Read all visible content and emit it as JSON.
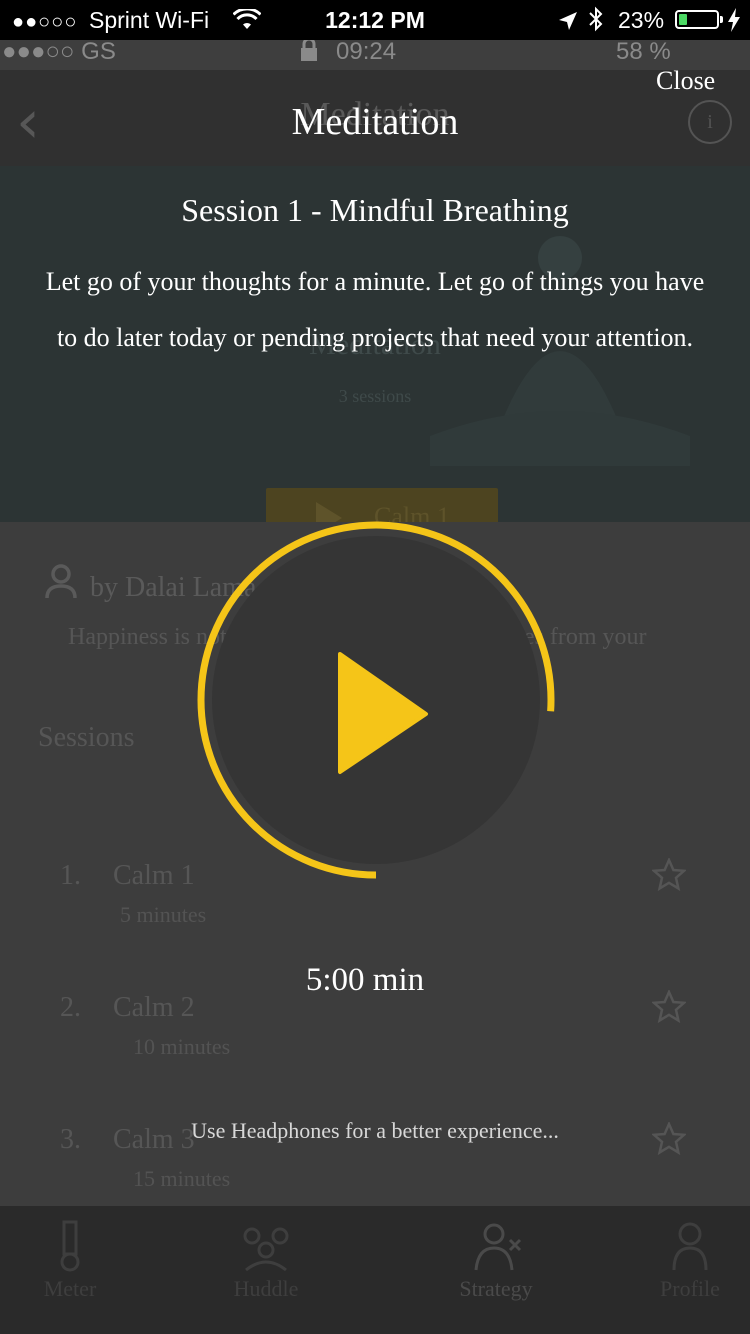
{
  "status_bar": {
    "signal_dots": "●●○○○",
    "carrier": "Sprint Wi-Fi",
    "time": "12:12 PM",
    "battery_percent": "23%",
    "battery_level": 0.23
  },
  "background_app": {
    "status_bar": {
      "signal": "●●●○○ GS",
      "time": "09:24",
      "battery": "58 %"
    },
    "nav_title": "Meditation",
    "hero": {
      "title": "Meditation",
      "subtitle": "3 sessions",
      "button_label": "Calm 1"
    },
    "author": "by Dalai Lama",
    "quote": "Happiness is not something ready made. It comes from your",
    "sessions_heading": "Sessions",
    "sessions": [
      {
        "number": "1.",
        "name": "Calm 1",
        "duration": "5 minutes"
      },
      {
        "number": "2.",
        "name": "Calm 2",
        "duration": "10 minutes"
      },
      {
        "number": "3.",
        "name": "Calm 3",
        "duration": "15 minutes"
      }
    ],
    "tabs": [
      {
        "label": "Meter",
        "icon": "meter-icon"
      },
      {
        "label": "Huddle",
        "icon": "huddle-icon"
      },
      {
        "label": "Strategy",
        "icon": "strategy-icon"
      },
      {
        "label": "Profile",
        "icon": "profile-icon"
      }
    ]
  },
  "modal": {
    "close_label": "Close",
    "title": "Meditation",
    "session_title": "Session 1 - Mindful Breathing",
    "description": "Let go of your thoughts for a minute. Let go of things you have to do later today or pending projects that need your attention.",
    "player": {
      "progress": 0.76,
      "accent_color": "#f5c518",
      "state": "paused"
    },
    "time_label": "5:00 min",
    "hint": "Use Headphones for a better experience..."
  }
}
